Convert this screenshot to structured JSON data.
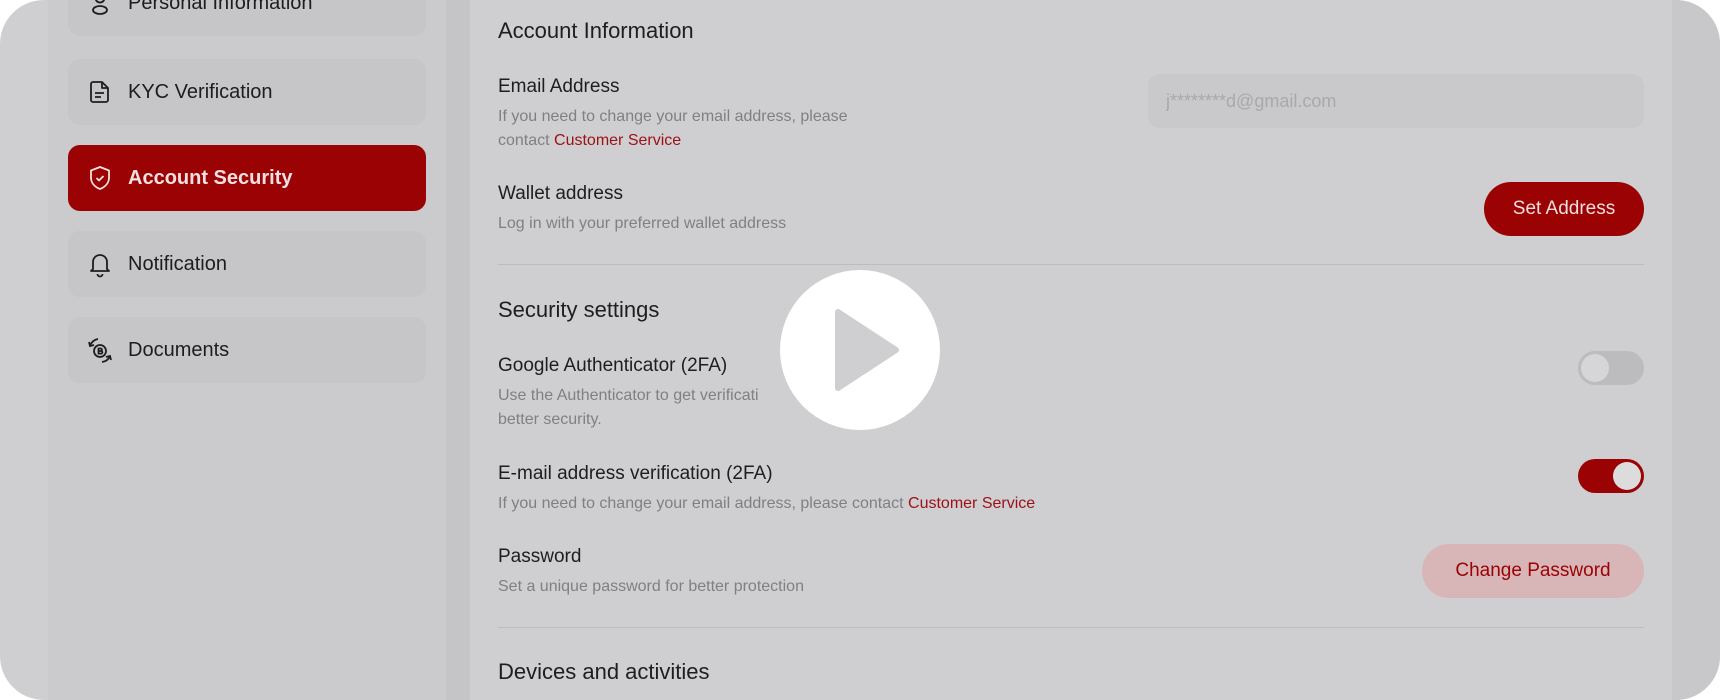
{
  "sidebar": {
    "items": [
      {
        "label": "Personal Information",
        "icon": "user-icon"
      },
      {
        "label": "KYC Verification",
        "icon": "document-icon"
      },
      {
        "label": "Account Security",
        "icon": "shield-check-icon",
        "active": true
      },
      {
        "label": "Notification",
        "icon": "bell-icon"
      },
      {
        "label": "Documents",
        "icon": "coins-exchange-icon"
      }
    ]
  },
  "account": {
    "title": "Account Information",
    "email": {
      "label": "Email Address",
      "desc_line1": "If you need to change your email address, please",
      "desc_line2": "contact ",
      "link": "Customer Service",
      "placeholder": "j********d@gmail.com"
    },
    "wallet": {
      "label": "Wallet address",
      "desc": "Log in with your preferred wallet address",
      "button": "Set Address"
    }
  },
  "security": {
    "title": "Security settings",
    "google": {
      "label": "Google Authenticator (2FA)",
      "desc_line1": "Use the Authenticator to get verificati",
      "desc_line2": "better security.",
      "enabled": false
    },
    "email_verify": {
      "label": "E-mail address verification (2FA)",
      "desc": "If you need to change your email address, please contact ",
      "link": "Customer Service",
      "enabled": true
    },
    "password": {
      "label": "Password",
      "desc": "Set a unique password for better protection",
      "button": "Change Password"
    }
  },
  "devices": {
    "title": "Devices and activities"
  },
  "colors": {
    "accent": "#9b0204",
    "accent_soft": "#d8b6b8",
    "background": "#cfcfd1"
  },
  "overlay": {
    "icon": "play-icon"
  }
}
